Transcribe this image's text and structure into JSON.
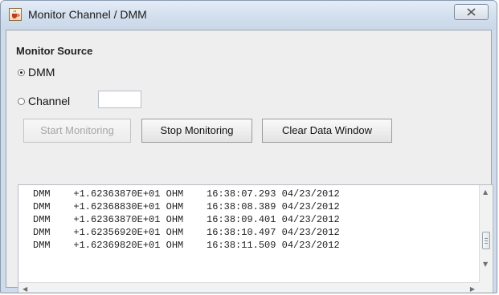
{
  "window": {
    "title": "Monitor Channel / DMM"
  },
  "monitor_source": {
    "label": "Monitor Source",
    "options": [
      {
        "label": "DMM",
        "selected": true
      },
      {
        "label": "Channel",
        "selected": false
      }
    ],
    "channel_value": ""
  },
  "buttons": {
    "start": {
      "label": "Start Monitoring",
      "enabled": false
    },
    "stop": {
      "label": "Stop Monitoring",
      "enabled": true
    },
    "clear": {
      "label": "Clear Data Window",
      "enabled": true
    }
  },
  "data_window": {
    "lines": [
      "DMM    +1.62363870E+01 OHM    16:38:07.293 04/23/2012",
      "DMM    +1.62368830E+01 OHM    16:38:08.389 04/23/2012",
      "DMM    +1.62363870E+01 OHM    16:38:09.401 04/23/2012",
      "DMM    +1.62356920E+01 OHM    16:38:10.497 04/23/2012",
      "DMM    +1.62369820E+01 OHM    16:38:11.509 04/23/2012"
    ]
  },
  "icons": {
    "title": "java-cup-icon",
    "close": "close-icon"
  },
  "colors": {
    "titlebar": "#d3dfee",
    "client_bg": "#eeeeee",
    "disabled_text": "#a7a7a7"
  }
}
